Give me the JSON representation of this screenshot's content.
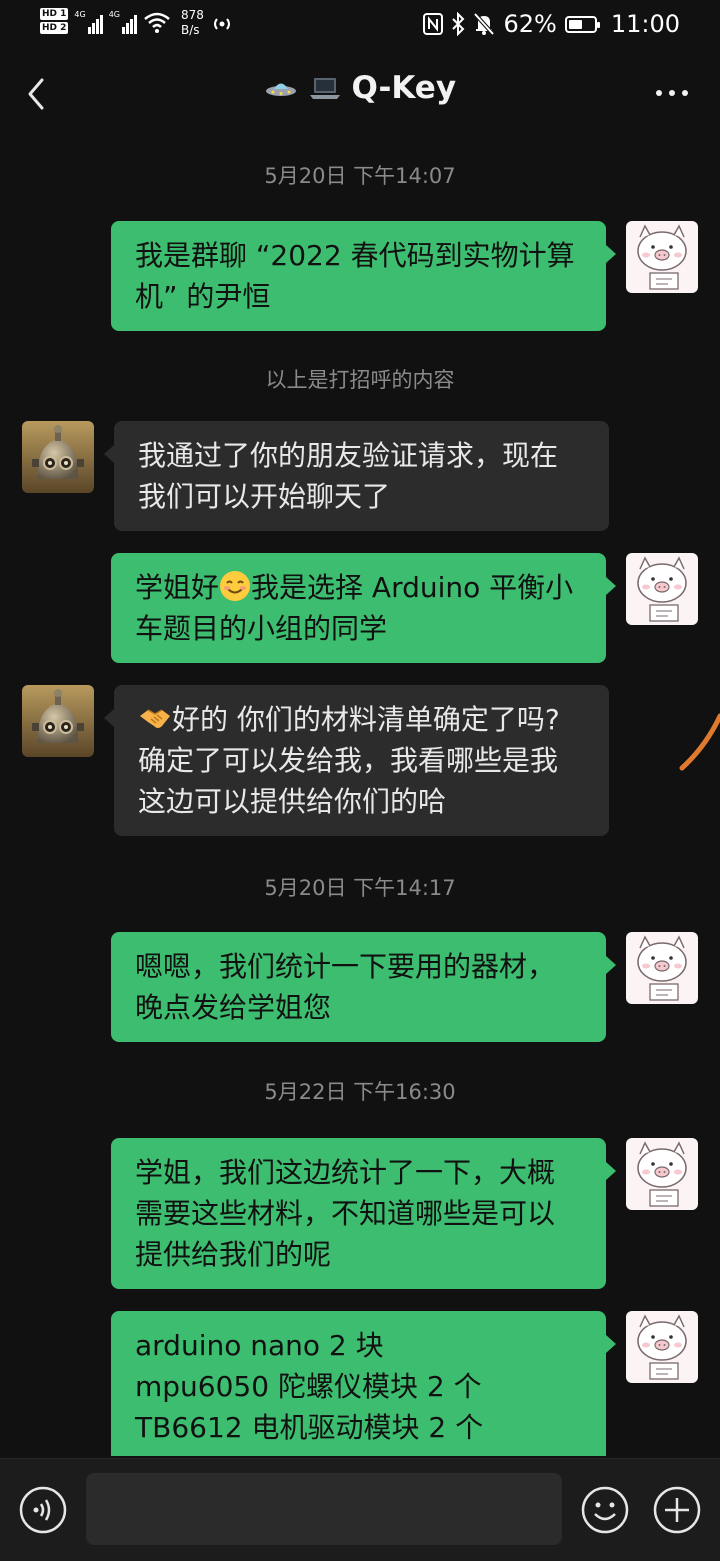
{
  "status_bar": {
    "hd1": "HD 1",
    "hd2": "HD 2",
    "net1": "4G",
    "net2": "4G",
    "speed_value": "878",
    "speed_unit": "B/s",
    "battery": "62%",
    "battery_level": 0.62,
    "time": "11:00"
  },
  "header": {
    "title": "Q-Key"
  },
  "messages": {
    "t1": "5月20日 下午14:07",
    "m1": "我是群聊 “2022 春代码到实物计算机” 的尹恒",
    "sys1": "以上是打招呼的内容",
    "m2": "我通过了你的朋友验证请求，现在我们可以开始聊天了",
    "m3a": "学姐好",
    "m3b": "我是选择 Arduino 平衡小车题目的小组的同学",
    "m4": "好的 你们的材料清单确定了吗? 确定了可以发给我，我看哪些是我这边可以提供给你们的哈",
    "t2": "5月20日 下午14:17",
    "m5": "嗯嗯，我们统计一下要用的器材，晚点发给学姐您",
    "t3": "5月22日 下午16:30",
    "m6": "学姐，我们这边统计了一下，大概需要这些材料，不知道哪些是可以提供给我们的呢",
    "m7_l1": "arduino nano 2 块",
    "m7_l2": "mpu6050 陀螺仪模块 2 个",
    "m7_l3": "TB6612 电机驱动模块 2 个"
  },
  "icons": {
    "back": "back-arrow-icon",
    "more": "more-dots-icon",
    "voice": "voice-icon",
    "emoji": "emoji-icon",
    "add": "plus-icon"
  },
  "colors": {
    "outgoing_bubble": "#3dbd6f",
    "incoming_bubble": "#2c2c2c",
    "background": "#111111"
  }
}
